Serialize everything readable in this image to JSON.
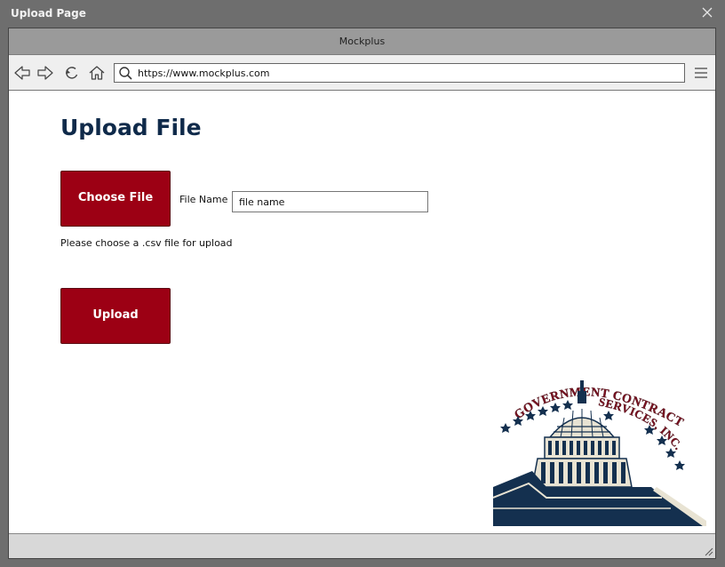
{
  "window": {
    "title": "Upload Page"
  },
  "browser": {
    "tab_title": "Mockplus",
    "url": "https://www.mockplus.com"
  },
  "page": {
    "title": "Upload File",
    "choose_file_label": "Choose File",
    "file_name_label": "File Name",
    "file_name_value": "file name",
    "hint": "Please choose a .csv file for upload",
    "upload_label": "Upload"
  },
  "logo": {
    "text_line1": "GOVERNMENT CONTRACT",
    "text_line2": "SERVICES, INC."
  },
  "colors": {
    "accent_red": "#9c0014",
    "title_navy": "#0f2a4a",
    "logo_red": "#7a1020",
    "logo_navy": "#14304f",
    "logo_cream": "#e8e3d3"
  },
  "icons": [
    "close-icon",
    "back-icon",
    "forward-icon",
    "refresh-icon",
    "home-icon",
    "search-icon",
    "menu-icon",
    "resize-grip-icon"
  ]
}
